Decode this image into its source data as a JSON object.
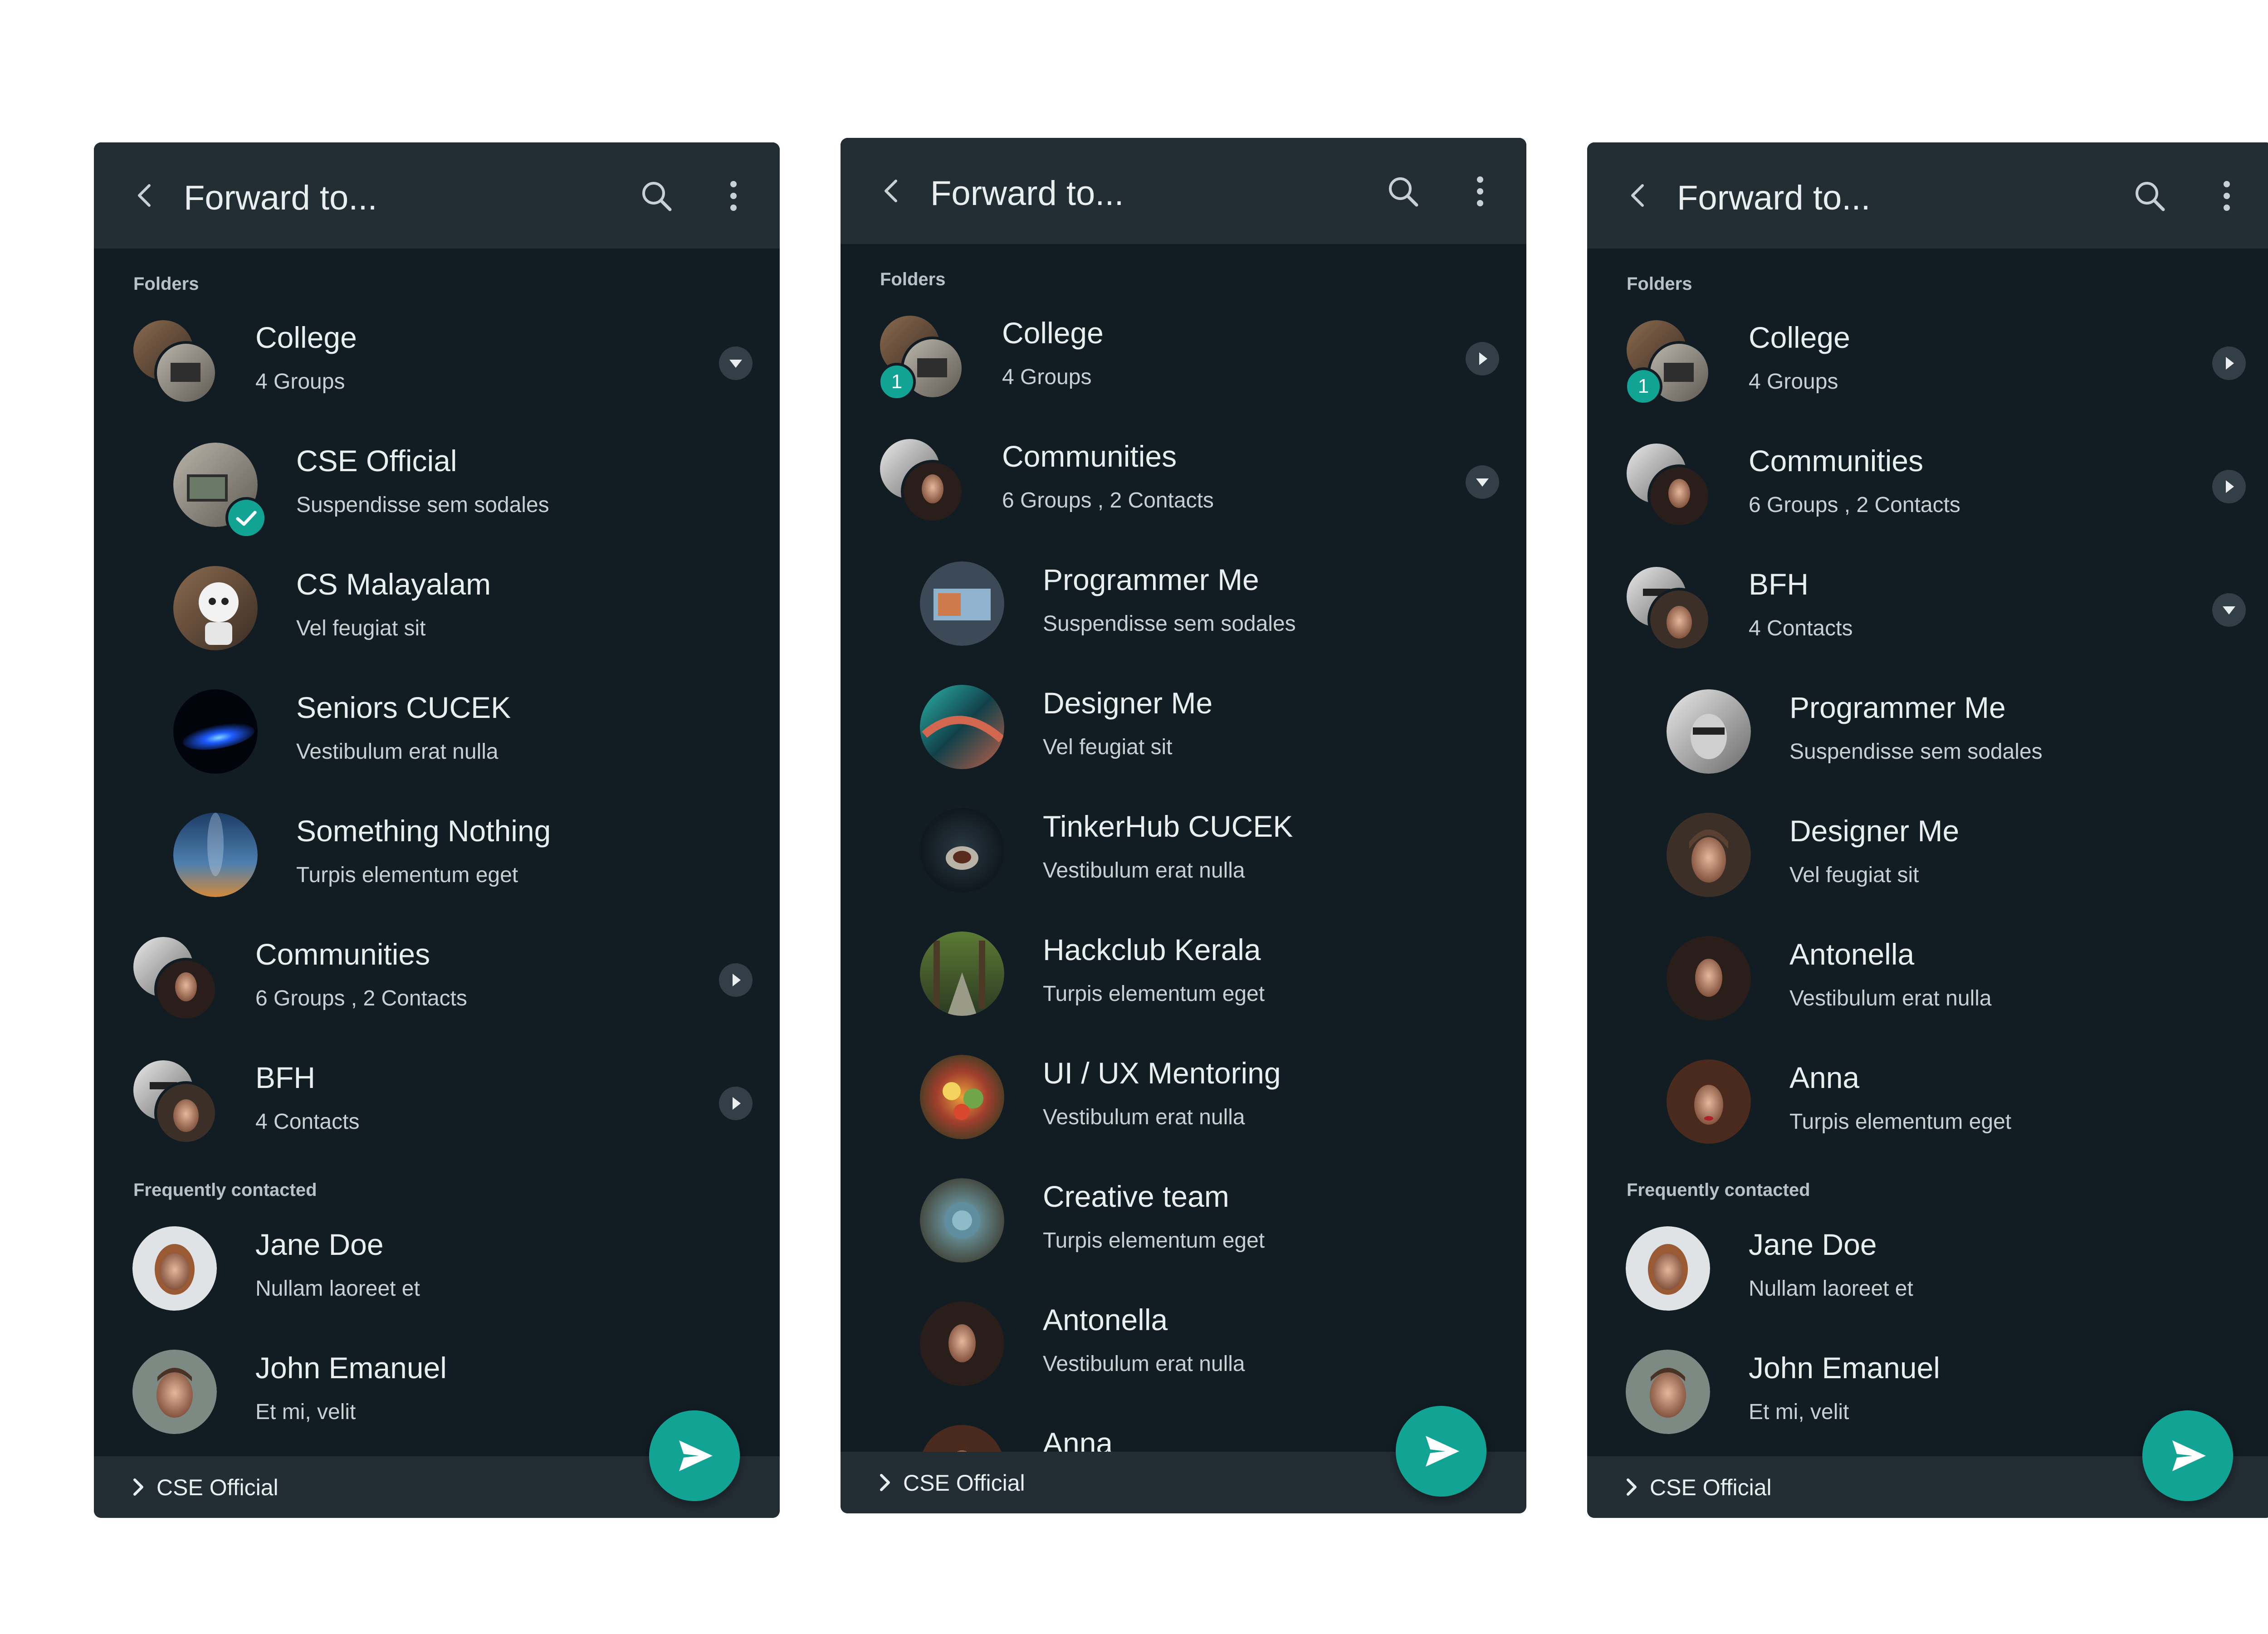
{
  "colors": {
    "panel_bg": "#111c23",
    "bar_bg": "#232d34",
    "accent": "#11a393",
    "text_primary": "#e9eef1",
    "text_secondary": "#c8d0d4"
  },
  "header": {
    "title": "Forward to...",
    "back_icon": "chevron-left-icon",
    "search_icon": "search-icon",
    "more_icon": "more-vertical-icon"
  },
  "sections": {
    "folders": "Folders",
    "frequent": "Frequently contacted"
  },
  "bottom": {
    "crumb": "CSE Official",
    "send_icon": "send-icon"
  },
  "panels": [
    {
      "folders": [
        {
          "name": "College",
          "sub": "4 Groups",
          "state": "expanded"
        },
        {
          "name": "Communities",
          "sub": "6 Groups , 2 Contacts",
          "state": "collapsed"
        },
        {
          "name": "BFH",
          "sub": "4 Contacts",
          "state": "collapsed"
        }
      ],
      "college_children": [
        {
          "name": "CSE Official",
          "sub": "Suspendisse sem sodales",
          "selected": true
        },
        {
          "name": "CS Malayalam",
          "sub": "Vel feugiat sit"
        },
        {
          "name": "Seniors CUCEK",
          "sub": "Vestibulum erat nulla"
        },
        {
          "name": "Something Nothing",
          "sub": "Turpis elementum eget"
        }
      ],
      "frequent": [
        {
          "name": "Jane Doe",
          "sub": "Nullam laoreet et"
        },
        {
          "name": "John Emanuel",
          "sub": "Et mi, velit"
        }
      ]
    },
    {
      "folders": [
        {
          "name": "College",
          "sub": "4 Groups",
          "state": "collapsed",
          "badge": "1"
        },
        {
          "name": "Communities",
          "sub": "6 Groups , 2 Contacts",
          "state": "expanded"
        }
      ],
      "communities_children": [
        {
          "name": "Programmer Me",
          "sub": "Suspendisse sem sodales"
        },
        {
          "name": "Designer Me",
          "sub": "Vel feugiat sit"
        },
        {
          "name": "TinkerHub CUCEK",
          "sub": "Vestibulum erat nulla"
        },
        {
          "name": "Hackclub Kerala",
          "sub": "Turpis elementum eget"
        },
        {
          "name": "UI / UX Mentoring",
          "sub": "Vestibulum erat nulla"
        },
        {
          "name": "Creative team",
          "sub": "Turpis elementum eget"
        },
        {
          "name": "Antonella",
          "sub": "Vestibulum erat nulla"
        },
        {
          "name": "Anna",
          "sub": ""
        }
      ]
    },
    {
      "folders": [
        {
          "name": "College",
          "sub": "4 Groups",
          "state": "collapsed",
          "badge": "1"
        },
        {
          "name": "Communities",
          "sub": "6 Groups , 2 Contacts",
          "state": "collapsed"
        },
        {
          "name": "BFH",
          "sub": "4 Contacts",
          "state": "expanded"
        }
      ],
      "bfh_children": [
        {
          "name": "Programmer Me",
          "sub": "Suspendisse sem sodales"
        },
        {
          "name": "Designer Me",
          "sub": "Vel feugiat sit"
        },
        {
          "name": "Antonella",
          "sub": "Vestibulum erat nulla"
        },
        {
          "name": "Anna",
          "sub": "Turpis elementum eget"
        }
      ],
      "frequent": [
        {
          "name": "Jane Doe",
          "sub": "Nullam laoreet et"
        },
        {
          "name": "John Emanuel",
          "sub": "Et mi, velit"
        }
      ]
    }
  ]
}
